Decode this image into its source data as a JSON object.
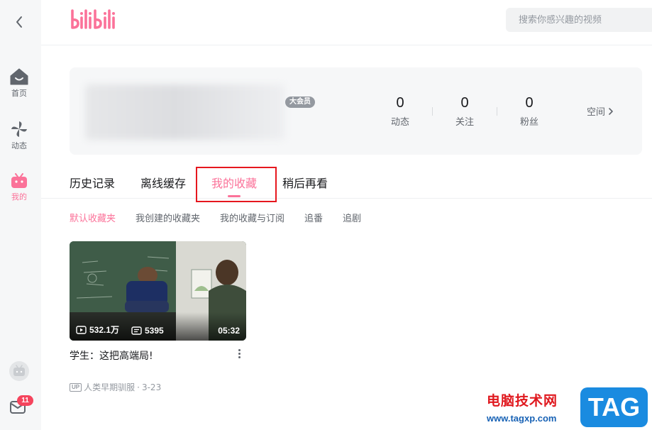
{
  "brand": {
    "logo_text": "bilibili",
    "accent": "#fb7299"
  },
  "sidebar": {
    "items": [
      {
        "label": "首页",
        "icon": "home-icon",
        "active": false
      },
      {
        "label": "动态",
        "icon": "pinwheel-icon",
        "active": false
      },
      {
        "label": "我的",
        "icon": "tv-mascot-icon",
        "active": true
      }
    ],
    "mail_badge": "11"
  },
  "search": {
    "placeholder": "搜索你感兴趣的视频"
  },
  "profile": {
    "vip_label": "大会员",
    "stats": [
      {
        "value": "0",
        "label": "动态"
      },
      {
        "value": "0",
        "label": "关注"
      },
      {
        "value": "0",
        "label": "粉丝"
      }
    ],
    "space_label": "空间"
  },
  "tabs": [
    {
      "label": "历史记录",
      "active": false
    },
    {
      "label": "离线缓存",
      "active": false
    },
    {
      "label": "我的收藏",
      "active": true
    },
    {
      "label": "稍后再看",
      "active": false
    }
  ],
  "subtabs": [
    {
      "label": "默认收藏夹",
      "active": true
    },
    {
      "label": "我创建的收藏夹",
      "active": false
    },
    {
      "label": "我的收藏与订阅",
      "active": false
    },
    {
      "label": "追番",
      "active": false
    },
    {
      "label": "追剧",
      "active": false
    }
  ],
  "videos": [
    {
      "title": "学生：这把高端局!",
      "views": "532.1万",
      "danmaku": "5395",
      "duration": "05:32",
      "up_tag": "UP",
      "uploader": "人类早期驯服",
      "date": "3-23"
    }
  ],
  "watermark": {
    "text": "电脑技术网",
    "url": "www.tagxp.com",
    "tag": "TAG"
  }
}
